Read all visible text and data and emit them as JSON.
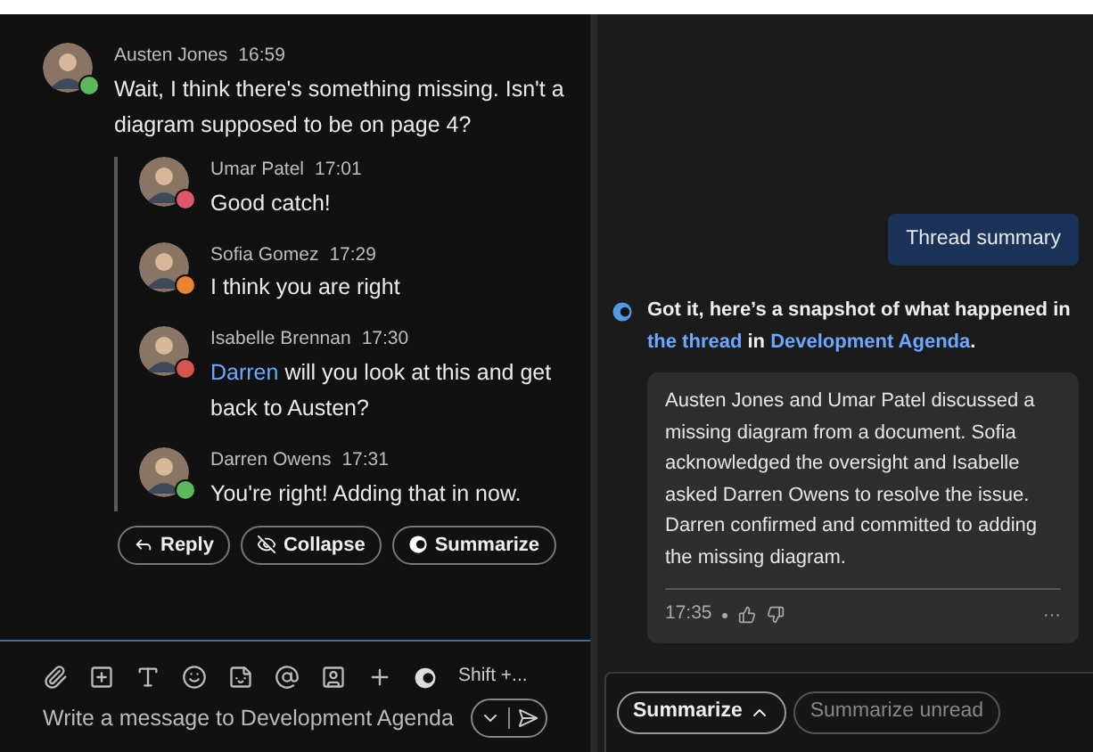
{
  "thread": {
    "root": {
      "author": "Austen Jones",
      "time": "16:59",
      "text": "Wait, I think there's something missing. Isn't a diagram supposed to be on page 4?",
      "color": "#5cb85c"
    },
    "replies": [
      {
        "author": "Umar Patel",
        "time": "17:01",
        "text": "Good catch!",
        "color": "#e0566b"
      },
      {
        "author": "Sofia Gomez",
        "time": "17:29",
        "text": "I think you are right",
        "color": "#e9832e"
      },
      {
        "author": "Isabelle Brennan",
        "time": "17:30",
        "mention": "Darren",
        "text": "will you look at this and get back to Austen?",
        "color": "#d9534f"
      },
      {
        "author": "Darren Owens",
        "time": "17:31",
        "text": "You're right! Adding that in now.",
        "color": "#5cb85c"
      }
    ],
    "actions": [
      "Reply",
      "Collapse",
      "Summarize"
    ]
  },
  "composer": {
    "shortcut": "Shift +...",
    "placeholder": "Write a message to Development Agenda"
  },
  "copilot": {
    "request": "Thread summary",
    "headline": [
      {
        "kind": "text",
        "text": "Got it, here’s a snapshot of what happened in "
      },
      {
        "kind": "link",
        "text": "the thread"
      },
      {
        "kind": "text",
        "text": " in "
      },
      {
        "kind": "link",
        "text": "Development Agenda"
      },
      {
        "kind": "text",
        "text": "."
      }
    ],
    "summary": "Austen Jones and Umar Patel discussed a missing diagram from a document. Sofia acknowledged the oversight and Isabelle asked Darren Owens to resolve the issue. Darren confirmed and committed to adding the missing diagram.",
    "time": "17:35",
    "more": "···",
    "prompts": [
      {
        "label": "Summarize",
        "expanded": true
      },
      {
        "label": "Summarize unread"
      }
    ]
  }
}
